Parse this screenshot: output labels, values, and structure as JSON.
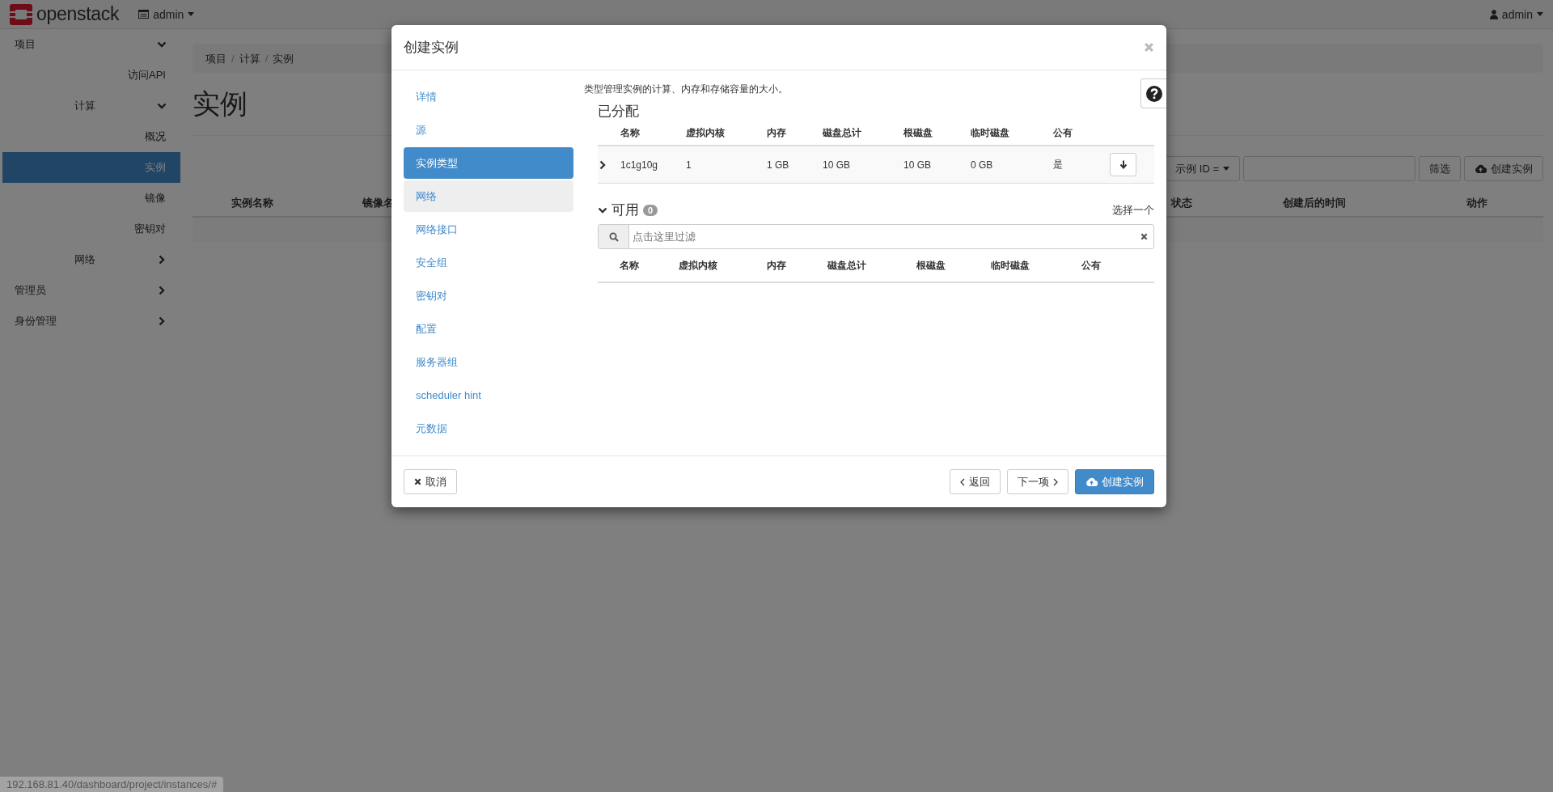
{
  "header": {
    "logo": "openstack",
    "project_menu": "admin",
    "user_menu": "admin"
  },
  "sidebar": {
    "items": [
      {
        "label": "项目",
        "kind": "group",
        "expanded": true,
        "selected": false,
        "children": [
          {
            "label": "访问API",
            "kind": "link",
            "selected": false
          },
          {
            "label": "计算",
            "kind": "group",
            "expanded": true,
            "selected": false,
            "children": [
              {
                "label": "概况",
                "kind": "link",
                "selected": false
              },
              {
                "label": "实例",
                "kind": "link",
                "selected": true
              },
              {
                "label": "镜像",
                "kind": "link",
                "selected": false
              },
              {
                "label": "密钥对",
                "kind": "link",
                "selected": false
              }
            ]
          },
          {
            "label": "网络",
            "kind": "group",
            "expanded": false,
            "selected": false
          }
        ]
      },
      {
        "label": "管理员",
        "kind": "group",
        "expanded": false,
        "selected": false
      },
      {
        "label": "身份管理",
        "kind": "group",
        "expanded": false,
        "selected": false
      }
    ]
  },
  "breadcrumb": [
    {
      "label": "项目",
      "separator": "/"
    },
    {
      "label": "计算",
      "separator": "/"
    },
    {
      "label": "实例"
    }
  ],
  "page_title": "实例",
  "toolbar": {
    "filter_field": "示例 ID =",
    "filter_button": "筛选",
    "create_button": "创建实例"
  },
  "table": {
    "columns": [
      "实例名称",
      "镜像名",
      "状态",
      "创建后的时间",
      "动作"
    ]
  },
  "modal": {
    "title": "创建实例",
    "steps": [
      {
        "label": "详情",
        "selected": false,
        "highlighted": false
      },
      {
        "label": "源",
        "selected": false,
        "highlighted": false
      },
      {
        "label": "实例类型",
        "selected": true,
        "highlighted": false
      },
      {
        "label": "网络",
        "selected": false,
        "highlighted": true
      },
      {
        "label": "网络接口",
        "selected": false,
        "highlighted": false
      },
      {
        "label": "安全组",
        "selected": false,
        "highlighted": false
      },
      {
        "label": "密钥对",
        "selected": false,
        "highlighted": false
      },
      {
        "label": "配置",
        "selected": false,
        "highlighted": false
      },
      {
        "label": "服务器组",
        "selected": false,
        "highlighted": false
      },
      {
        "label": "scheduler hint",
        "selected": false,
        "highlighted": false
      },
      {
        "label": "元数据",
        "selected": false,
        "highlighted": false
      }
    ],
    "description": "类型管理实例的计算、内存和存储容量的大小。",
    "allocated": {
      "title": "已分配",
      "columns": [
        "名称",
        "虚拟内核",
        "内存",
        "磁盘总计",
        "根磁盘",
        "临时磁盘",
        "公有"
      ],
      "rows": [
        {
          "expanded": false,
          "cells": [
            "1c1g10g",
            "1",
            "1 GB",
            "10 GB",
            "10 GB",
            "0 GB",
            "是"
          ]
        }
      ]
    },
    "available": {
      "title": "可用",
      "expanded": true,
      "count": "0",
      "select_hint": "选择一个",
      "filter_placeholder": "点击这里过滤",
      "columns": [
        "名称",
        "虚拟内核",
        "内存",
        "磁盘总计",
        "根磁盘",
        "临时磁盘",
        "公有"
      ]
    },
    "buttons": [
      {
        "label": "取消",
        "kind": "cancel"
      },
      {
        "label": "返回",
        "kind": "back"
      },
      {
        "label": "下一项",
        "kind": "next"
      },
      {
        "label": "创建实例",
        "kind": "primary"
      }
    ]
  },
  "status_url": "192.168.81.40/dashboard/project/instances/#"
}
